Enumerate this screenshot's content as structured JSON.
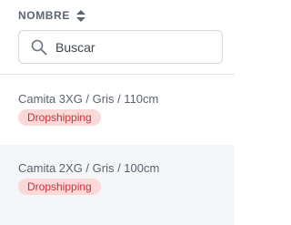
{
  "column": {
    "header": "NOMBRE",
    "sort_icon": "sort-updown-icon"
  },
  "search": {
    "placeholder": "Buscar",
    "value": "",
    "icon": "search-icon"
  },
  "colors": {
    "badge_bg": "#fbd9d9",
    "badge_text": "#c9323c",
    "alt_row_bg": "#f5f6f8"
  },
  "rows": [
    {
      "name": "Camita 3XG / Gris / 110cm",
      "badge": "Dropshipping"
    },
    {
      "name": "Camita 2XG / Gris / 100cm",
      "badge": "Dropshipping"
    }
  ]
}
